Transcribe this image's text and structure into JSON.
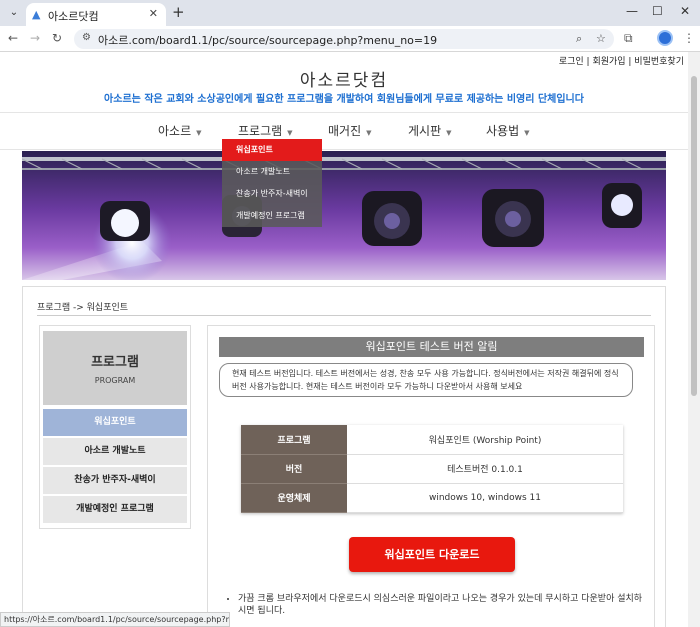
{
  "browser": {
    "tab_title": "아소르닷컴",
    "url": "아소르.com/board1.1/pc/source/sourcepage.php?menu_no=19",
    "status_url": "https://아소르.com/board1.1/pc/source/sourcepage.php?menu_n..."
  },
  "site": {
    "top_links": "로그인 | 회원가입 | 비밀번호찾기",
    "title": "아소르닷컴",
    "subtitle": "아소르는 작은 교회와 소상공인에게 필요한 프로그램을 개발하여 회원님들에게 무료로 제공하는 비영리 단체입니다"
  },
  "nav": {
    "items": [
      "아소르",
      "프로그램",
      "매거진",
      "게시판",
      "사용법"
    ],
    "dropdown": [
      "워십포인트",
      "아소르 개발노트",
      "찬송가 반주자-새벽이",
      "개발예정인 프로그램"
    ]
  },
  "breadcrumb": "프로그램 -> 워십포인트",
  "sidebar": {
    "title": "프로그램",
    "title_en": "PROGRAM",
    "items": [
      "워십포인트",
      "아소르 개발노트",
      "찬송가 반주자-새벽이",
      "개발예정인 프로그램"
    ]
  },
  "main": {
    "title": "워십포인트 테스트 버전 알림",
    "notice": "현재 테스트 버전입니다. 테스트 버전에서는 성경, 찬송 모두 사용 가능합니다. 정식버전에서는 저작권 해결뒤에 정식버전 사용가능합니다. 현재는 테스트 버전이라 모두 가능하니 다운받아서 사용해 보세요",
    "table": [
      {
        "key": "프로그램",
        "value": "워십포인트 (Worship Point)"
      },
      {
        "key": "버전",
        "value": "테스트버전 0.1.0.1"
      },
      {
        "key": "운영체제",
        "value": "windows 10, windows 11"
      }
    ],
    "download_label": "워십포인트 다운로드",
    "tips": [
      "가끔 크롬 브라우저에서 다운로드시 의심스러운 파일이라고 나오는 경우가 있는데 무시하고 다운받아 설치하시면 됩니다."
    ]
  }
}
